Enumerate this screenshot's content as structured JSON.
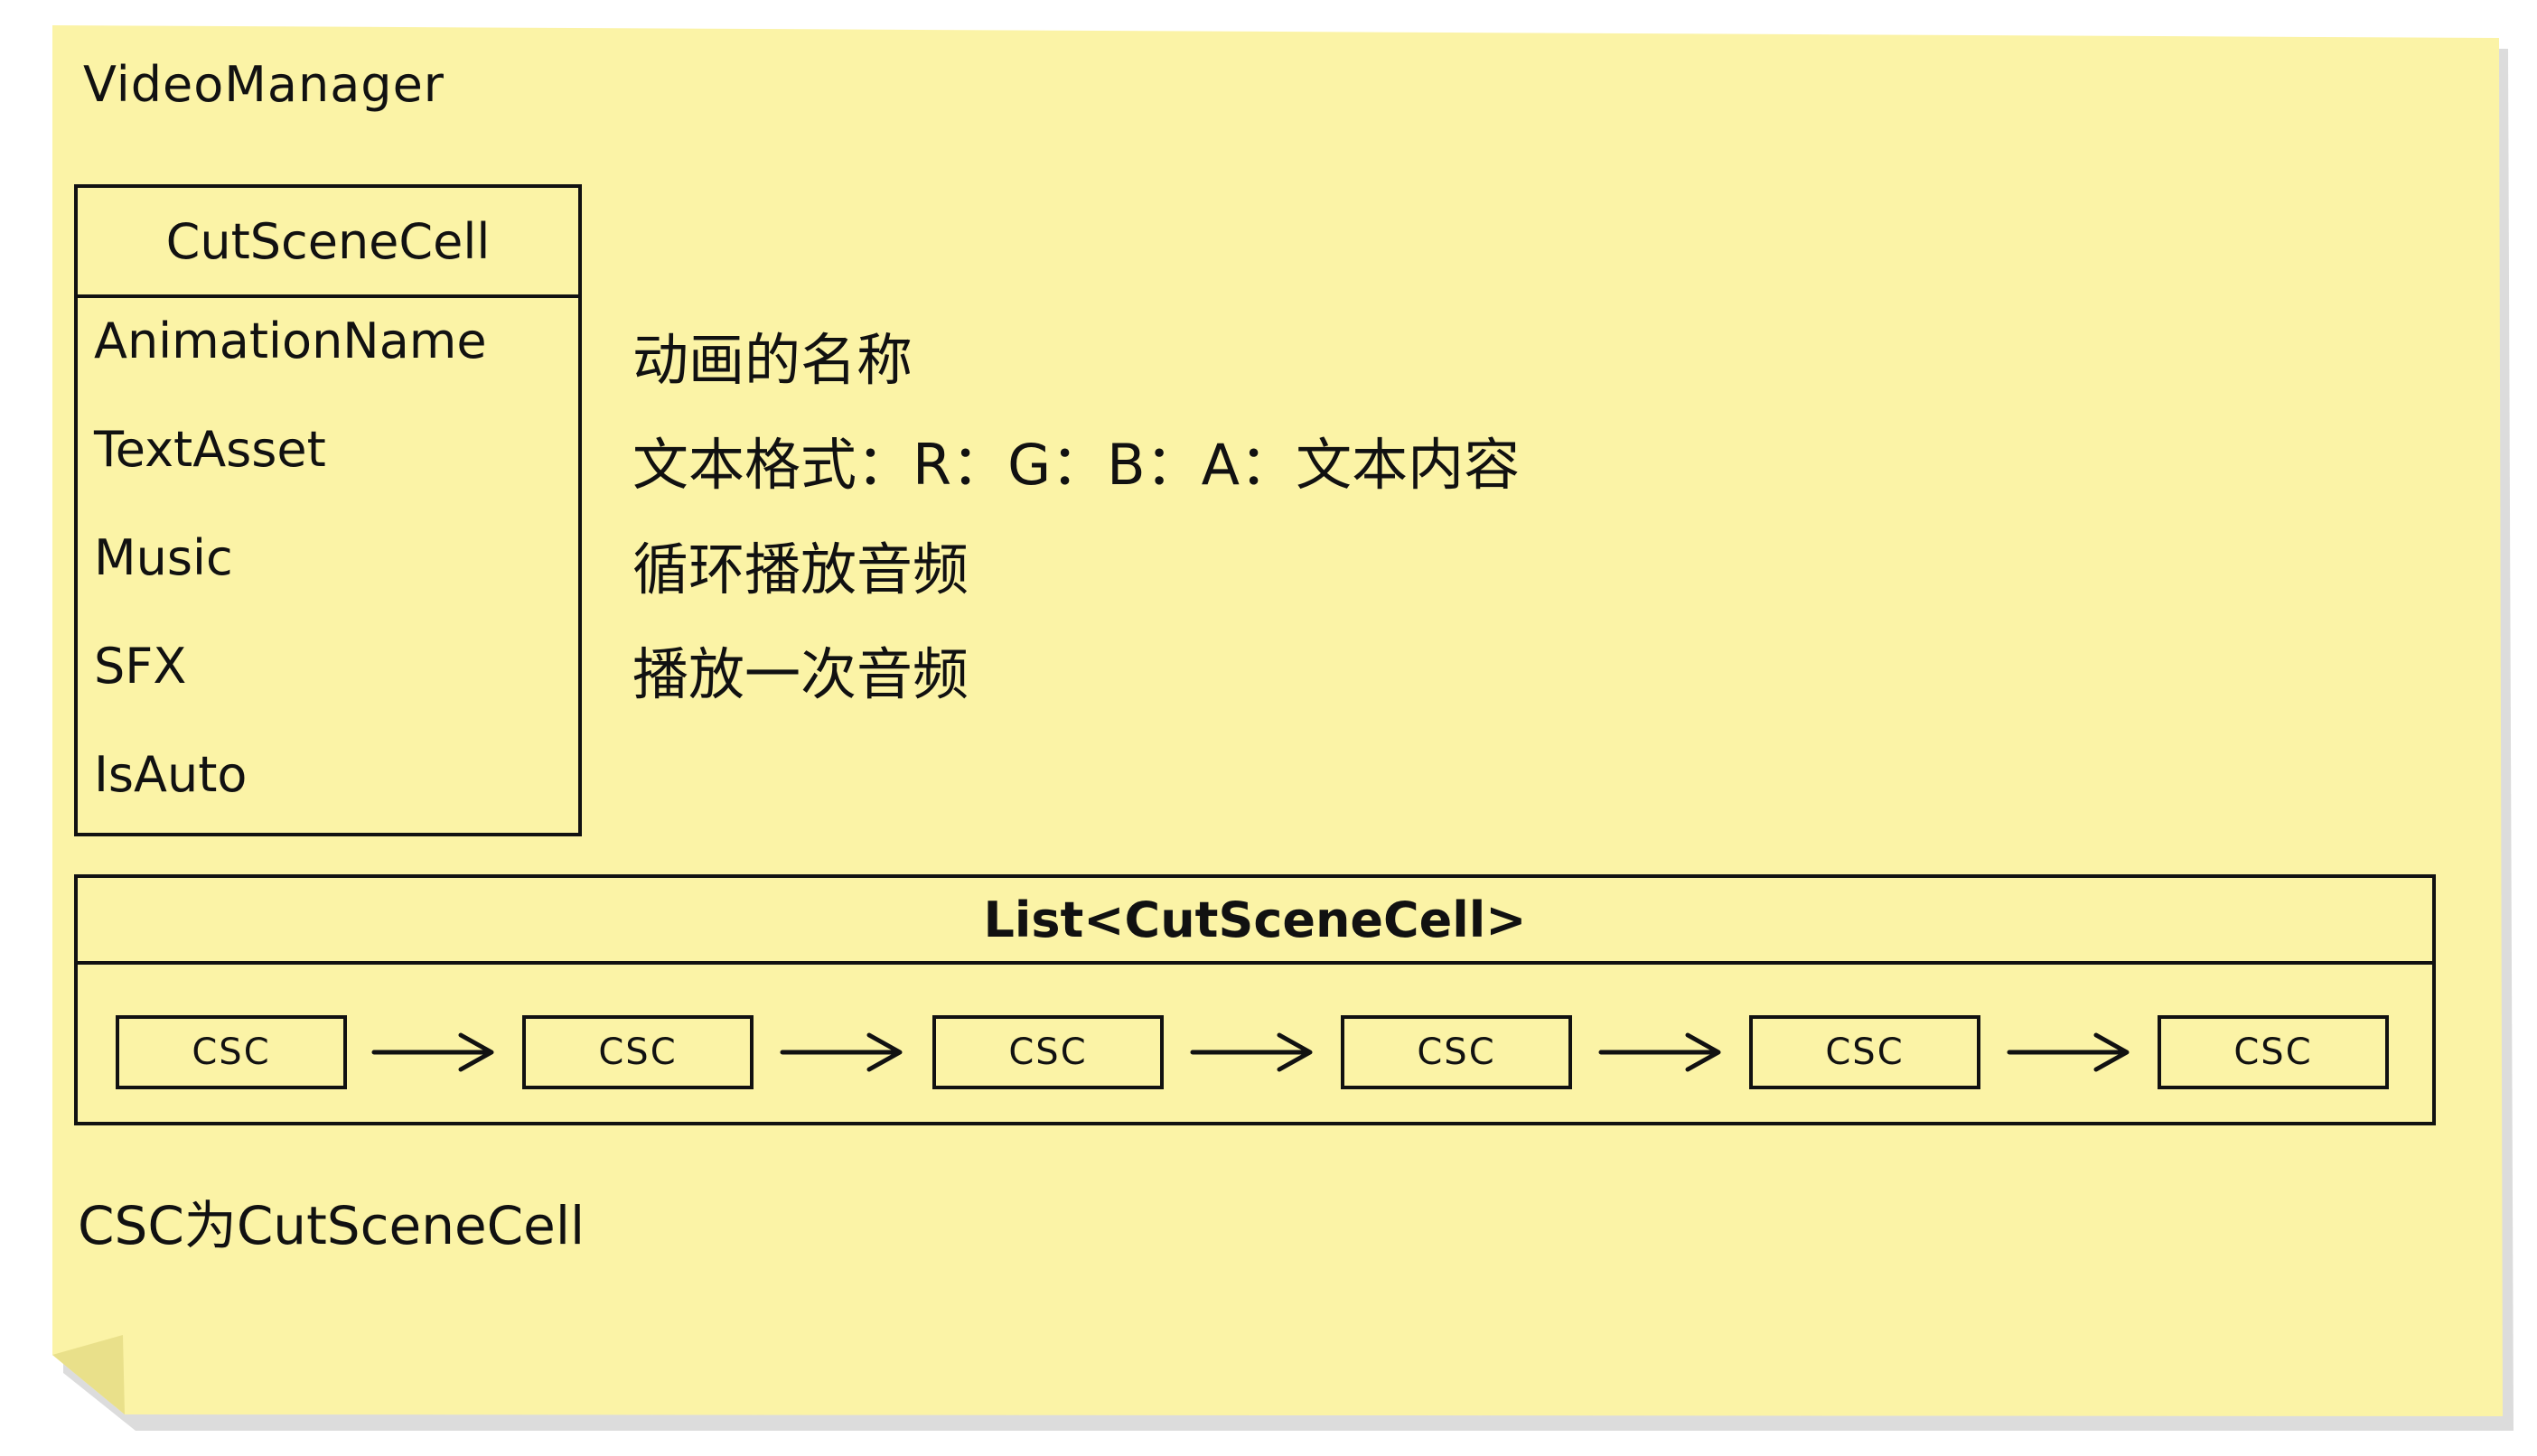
{
  "title": "VideoManager",
  "class_box": {
    "name": "CutSceneCell",
    "fields": [
      "AnimationName",
      "TextAsset",
      "Music",
      "SFX",
      "IsAuto"
    ]
  },
  "descriptions": [
    "动画的名称",
    "文本格式：R：G：B：A：文本内容",
    "循环播放音频",
    "播放一次音频"
  ],
  "list_box": {
    "title": "List<CutSceneCell>",
    "items": [
      "CSC",
      "CSC",
      "CSC",
      "CSC",
      "CSC",
      "CSC"
    ]
  },
  "footnote": "CSC为CutSceneCell",
  "colors": {
    "note": "#fbf3a6",
    "shadow": "#d6d6d6",
    "ink": "#111111"
  }
}
